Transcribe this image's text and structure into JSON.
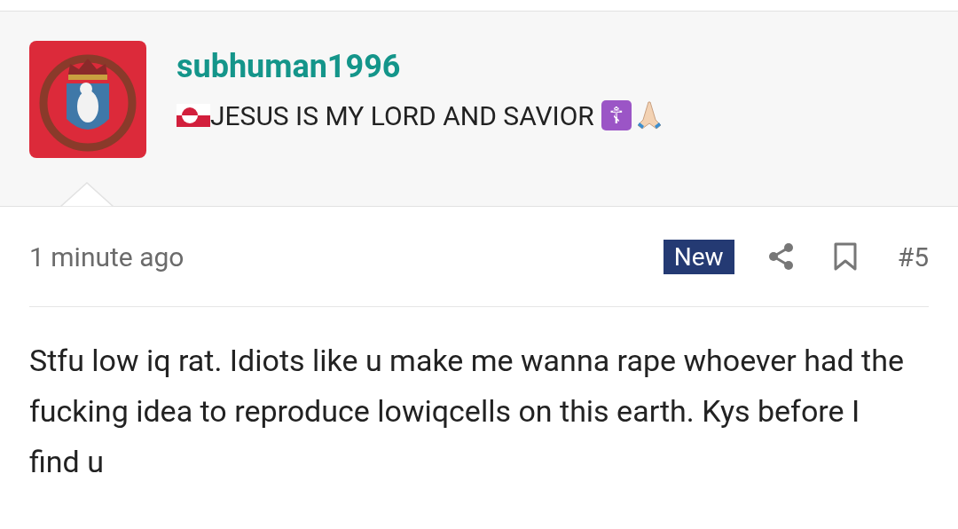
{
  "post": {
    "author": "subhuman1996",
    "signature": {
      "text": "JESUS IS MY LORD AND SAVIOR",
      "symbol": "☦"
    },
    "time": "1 minute ago",
    "badge": "New",
    "bookmarked": false,
    "number": "#5",
    "body": "Stfu low iq rat. Idiots like u make me wanna rape whoever had the fucking idea to reproduce lowiqcells on this earth. Kys before I find u"
  }
}
